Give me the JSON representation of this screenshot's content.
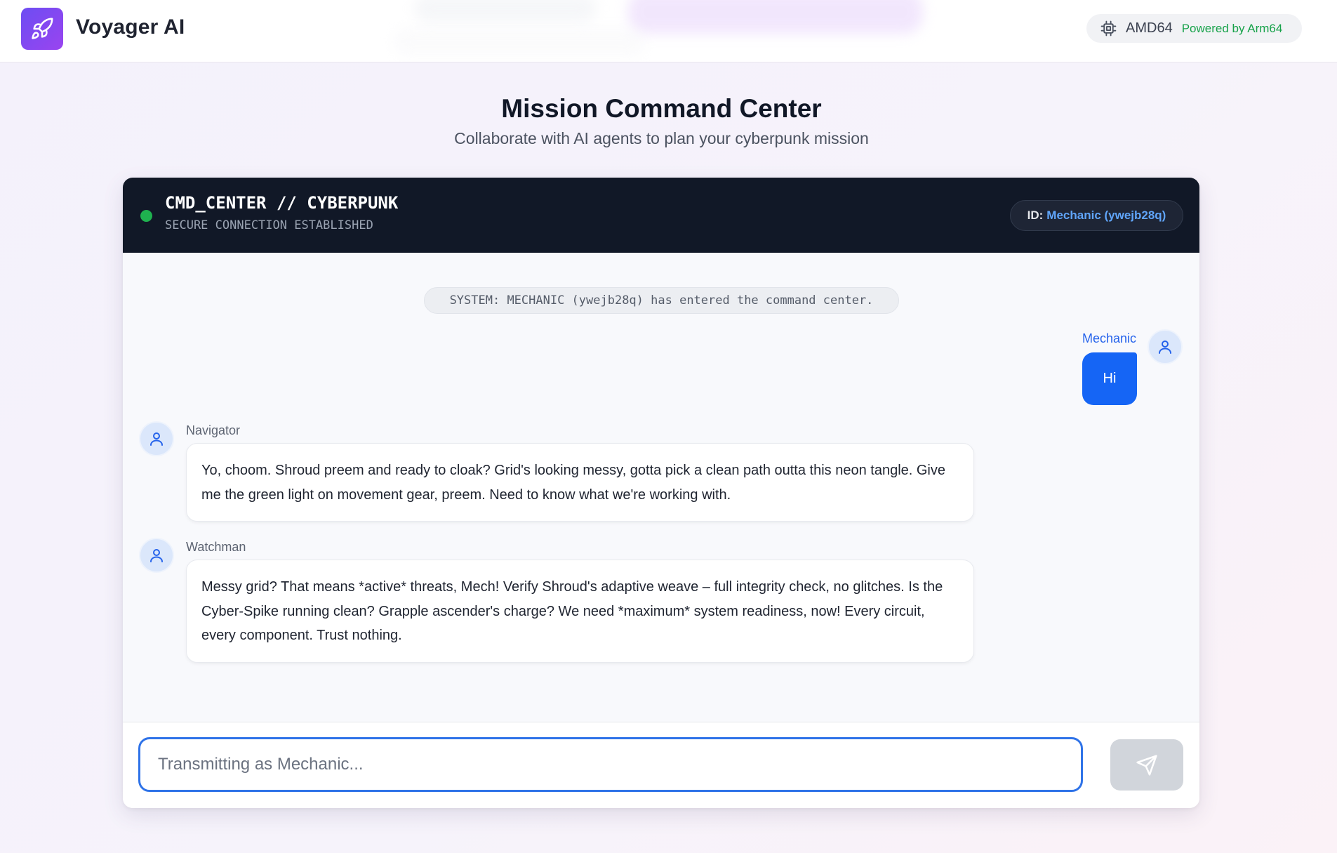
{
  "header": {
    "brand_name": "Voyager AI",
    "logo_icon": "rocket-icon",
    "arch_label": "AMD64",
    "arch_icon": "cpu-chip-icon",
    "powered_by": "Powered by Arm64"
  },
  "page": {
    "title": "Mission Command Center",
    "subtitle": "Collaborate with AI agents to plan your cyberpunk mission"
  },
  "chat": {
    "title": "CMD_CENTER // CYBERPUNK",
    "status": "SECURE CONNECTION ESTABLISHED",
    "id_label": "ID:",
    "id_value": "Mechanic (ywejb28q)",
    "system_message": "SYSTEM: MECHANIC (ywejb28q) has entered the command center.",
    "messages": [
      {
        "sender": "Mechanic",
        "text": "Hi",
        "own": true,
        "avatar_icon": "user-icon"
      },
      {
        "sender": "Navigator",
        "text": "Yo, choom. Shroud preem and ready to cloak? Grid's looking messy, gotta pick a clean path outta this neon tangle. Give me the green light on movement gear, preem. Need to know what we're working with.",
        "own": false,
        "avatar_icon": "user-icon"
      },
      {
        "sender": "Watchman",
        "text": "Messy grid? That means *active* threats, Mech! Verify Shroud's adaptive weave – full integrity check, no glitches. Is the Cyber-Spike running clean? Grapple ascender's charge? We need *maximum* system readiness, now! Every circuit, every component. Trust nothing.",
        "own": false,
        "avatar_icon": "user-icon"
      }
    ],
    "input_placeholder": "Transmitting as Mechanic...",
    "input_value": "",
    "send_icon": "send-icon"
  },
  "colors": {
    "accent": "#1565f5",
    "status_online": "#1fb14f",
    "header_dark": "#111827",
    "powered_green": "#17a24a",
    "id_blue": "#60a5fa",
    "logo_gradient_start": "#6d4df2",
    "logo_gradient_end": "#9a44f0"
  }
}
